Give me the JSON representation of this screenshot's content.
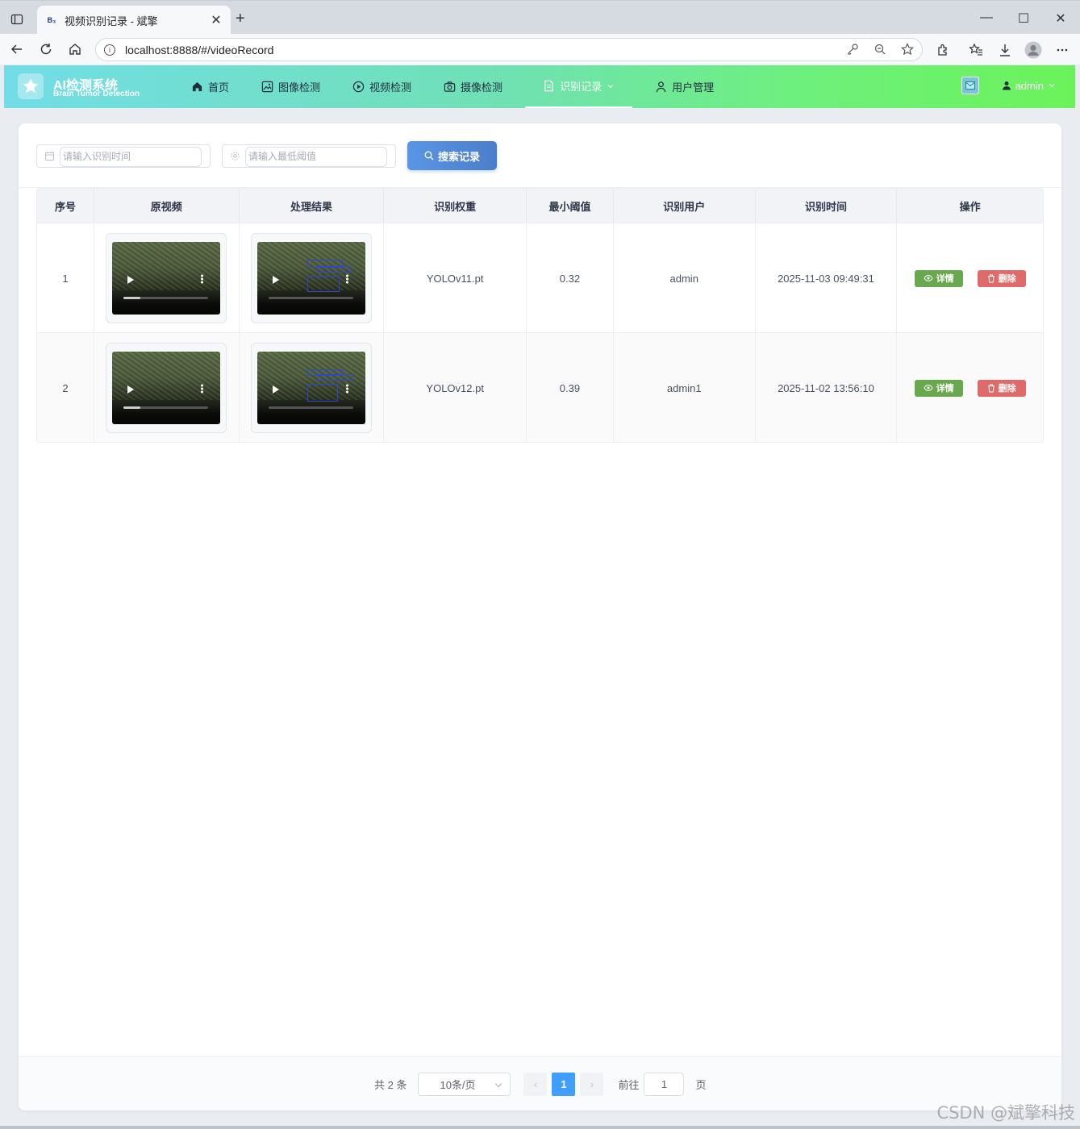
{
  "browser": {
    "tab_favicon": "B₃",
    "tab_title": "视频识别记录 - 斌擎",
    "url": "localhost:8888/#/videoRecord"
  },
  "header": {
    "title": "AI检测系统",
    "subtitle": "Brain Tumor Detection",
    "menu": [
      {
        "label": "首页",
        "icon": "home-icon"
      },
      {
        "label": "图像检测",
        "icon": "image-icon"
      },
      {
        "label": "视频检测",
        "icon": "play-circle-icon"
      },
      {
        "label": "摄像检测",
        "icon": "camera-icon"
      },
      {
        "label": "识别记录",
        "icon": "document-icon",
        "active": true
      },
      {
        "label": "用户管理",
        "icon": "user-icon"
      }
    ],
    "user": "admin",
    "accent_start": "#72dde6",
    "accent_end": "#6bf25a"
  },
  "search": {
    "time_placeholder": "请输入识别时间",
    "conf_placeholder": "请输入最低阈值",
    "button_label": "搜索记录"
  },
  "table": {
    "columns": [
      "序号",
      "原视频",
      "处理结果",
      "识别权重",
      "最小阈值",
      "识别用户",
      "识别时间",
      "操作"
    ],
    "rows": [
      {
        "index": "1",
        "weight": "YOLOv11.pt",
        "conf": "0.32",
        "user": "admin",
        "time": "2025-11-03 09:49:31",
        "original_progress": 0.2
      },
      {
        "index": "2",
        "weight": "YOLOv12.pt",
        "conf": "0.39",
        "user": "admin1",
        "time": "2025-11-02 13:56:10",
        "original_progress": 0.2
      }
    ],
    "detail_label": "详情",
    "delete_label": "删除"
  },
  "pagination": {
    "total": "共 2 条",
    "page_size": "10条/页",
    "current": "1",
    "goto_label": "前往",
    "goto_value": "1",
    "page_suffix": "页"
  },
  "watermark": "CSDN @斌擎科技"
}
